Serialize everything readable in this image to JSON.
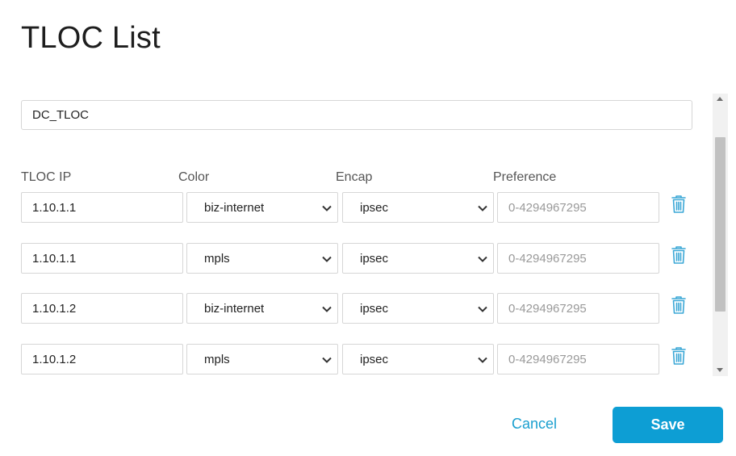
{
  "dialog": {
    "title": "TLOC List",
    "list_name": "DC_TLOC"
  },
  "columns": {
    "tloc_ip": "TLOC IP",
    "color": "Color",
    "encap": "Encap",
    "preference": "Preference"
  },
  "rows": [
    {
      "tloc_ip": "1.10.1.1",
      "color": "biz-internet",
      "encap": "ipsec",
      "preference": "",
      "preference_placeholder": "0-4294967295"
    },
    {
      "tloc_ip": "1.10.1.1",
      "color": "mpls",
      "encap": "ipsec",
      "preference": "",
      "preference_placeholder": "0-4294967295"
    },
    {
      "tloc_ip": "1.10.1.2",
      "color": "biz-internet",
      "encap": "ipsec",
      "preference": "",
      "preference_placeholder": "0-4294967295"
    },
    {
      "tloc_ip": "1.10.1.2",
      "color": "mpls",
      "encap": "ipsec",
      "preference": "",
      "preference_placeholder": "0-4294967295"
    }
  ],
  "icons": {
    "select_arrow": "chevron-down-icon",
    "delete_row": "trash-icon"
  },
  "footer": {
    "cancel_label": "Cancel",
    "save_label": "Save"
  },
  "colors": {
    "accent": "#0d9ed4",
    "link": "#1a9fcf",
    "trash_icon": "#3aa7d6"
  }
}
